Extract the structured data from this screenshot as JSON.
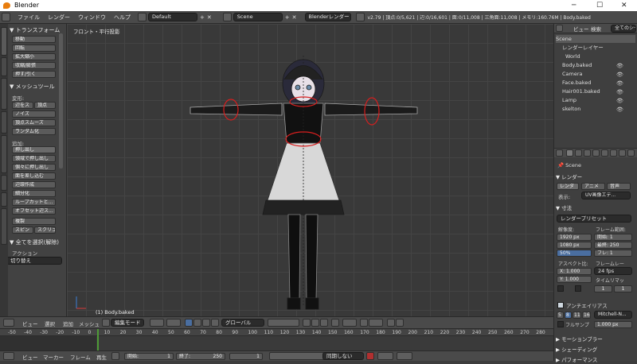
{
  "window": {
    "title": "Blender",
    "minimize": "─",
    "maximize": "☐",
    "close": "✕"
  },
  "menubar": {
    "items": [
      "ファイル",
      "レンダー",
      "ウィンドウ",
      "ヘルプ"
    ],
    "layout": "Default",
    "scene": "Scene",
    "engine": "Blenderレンダー",
    "stats": "v2.79 | 頂点:0/5,621 | 辺:0/16,601 | 面:0/11,008 | 三角面:11,008 | メモリ:160.76M | Body.baked"
  },
  "tool_shelf": {
    "tabs": [
      "ツール",
      "作成",
      "シェーディング/UV",
      "オプション",
      "Grease Pencil",
      "MMD",
      "UV",
      "VRM HELPER"
    ],
    "transform_header": "▼ トランスフォーム",
    "transform_buttons": [
      "移動",
      "回転",
      "拡大縮小",
      "収縮/膨張",
      "押す/引く"
    ],
    "mesh_tools_header": "▼ メッシュツール",
    "deform_label": "変形:",
    "deform_buttons": [
      "辺をス",
      "頂点",
      "ノイズ",
      "頂点スムーズ",
      "ランダム化"
    ],
    "add_label": "追加:",
    "extrude": "押し出し",
    "add_buttons": [
      "領域で押し出し",
      "個々に押し出し",
      "面を差し込む",
      "辺環作成",
      "細分化",
      "ループカットと...",
      "オフセット辺ス..."
    ],
    "dup": "複製",
    "spin": "スピン",
    "screw": "スクリュ",
    "select_header": "▼ 全てを選択(解除)",
    "action_label": "アクション",
    "action_value": "切り替え"
  },
  "viewport": {
    "view_name": "フロント・平行投影",
    "object_label": "(1) Body.baked"
  },
  "viewport_header": {
    "view": "ビュー",
    "select": "選択",
    "add": "追加",
    "mesh": "メッシュ",
    "mode": "編集モード",
    "orientation": "グローバル"
  },
  "timeline": {
    "ticks": [
      "-50",
      "-40",
      "-30",
      "-20",
      "-10",
      "0",
      "10",
      "20",
      "30",
      "40",
      "50",
      "60",
      "70",
      "80",
      "90",
      "100",
      "110",
      "120",
      "130",
      "140",
      "150",
      "160",
      "170",
      "180",
      "190",
      "200",
      "210",
      "220",
      "230",
      "240",
      "250",
      "260",
      "270",
      "280"
    ],
    "current_frame": "1"
  },
  "timeline_header": {
    "view": "ビュー",
    "marker": "マーカー",
    "frame": "フレーム",
    "playback": "再生",
    "start_label": "開始:",
    "start": "1",
    "end_label": "終了:",
    "end": "250",
    "current": "1",
    "sync": "同期しない"
  },
  "outliner": {
    "view": "ビュー",
    "search": "検索",
    "filter": "全てのシー",
    "items": [
      "Scene",
      "レンダーレイヤー",
      "World",
      "Body.baked",
      "Camera",
      "Face.baked",
      "Hair001.baked",
      "Lamp",
      "skelton"
    ]
  },
  "properties": {
    "scene_path": "Scene",
    "render_header": "▼ レンダー",
    "render_btns": [
      "レンダ",
      "アニメ",
      "音声"
    ],
    "display_label": "表示:",
    "display_value": "UV画像エデ...",
    "dims_header": "▼ 寸法",
    "preset": "レンダープリセット",
    "resolution_label": "解像度:",
    "frame_range_label": "フレーム範囲:",
    "res_x": "1920 px",
    "res_y": "1080 px",
    "res_pct": "50%",
    "frame_start": "開始: 1",
    "frame_end": "最終: 250",
    "frame_step": "フレ: 1",
    "aspect_label": "アスペクト比:",
    "frame_rate_label": "フレームレー",
    "aspect_x": "X: 1.000",
    "aspect_y": "Y: 1.000",
    "fps": "24 fps",
    "time_remap": "タイムリマッ",
    "remap_a": "1",
    "remap_b": "1",
    "aa_header": "アンチエイリアス",
    "aa_samples": [
      "5",
      "8",
      "11",
      "16"
    ],
    "aa_filter": "Mitchell-N...",
    "full_sample": "フルサンプ",
    "filter_size": "1.000 px",
    "motion_blur": "▶ モーションブラー",
    "shading": "▶ シェーディング",
    "performance": "▶ パフォーマンス"
  }
}
